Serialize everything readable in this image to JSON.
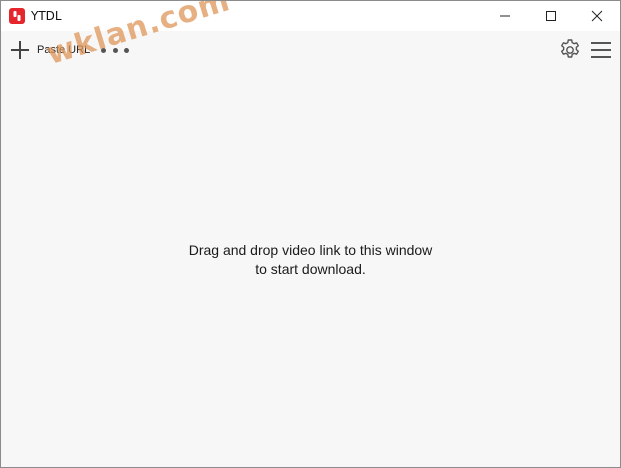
{
  "window": {
    "title": "YTDL",
    "app_icon": "ytdl-logo-icon",
    "accent_color": "#e5272d",
    "controls": [
      "minimize-icon",
      "maximize-icon",
      "close-icon"
    ]
  },
  "toolbar": {
    "paste_label": "Paste URL",
    "paste_icon": "plus-icon",
    "more_icon": "more-dots-icon",
    "settings_icon": "gear-icon",
    "menu_icon": "hamburger-menu-icon"
  },
  "watermark": {
    "text": "wklan.com"
  },
  "drop_zone": {
    "line1": "Drag and drop video link to this window",
    "line2": "to start download."
  }
}
